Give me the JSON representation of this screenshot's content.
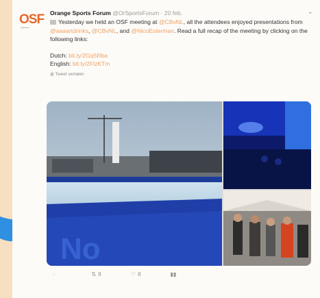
{
  "tweet": {
    "logo_text": "OSF",
    "author_name": "Orange Sports Forum",
    "handle": "@OrSportsForum",
    "time": "20 feb.",
    "body_prefix": "Yesterday we held an OSF meeting at",
    "mention1": "@CBvNL",
    "body_mid": ", all the attendees enjoyed presentations from",
    "mention2": "@aaaartdrinks",
    "sep1": ",",
    "mention3": "@CBvNL",
    "sep2": ", and",
    "mention4": "@NicoEsterman",
    "body_suffix": ". Read a full recap of the meeting by clicking on the following links:",
    "dutch_label": "Dutch:",
    "dutch_link": "bit.ly/2Gq5Rba",
    "english_label": "English:",
    "english_link": "bit.ly/2FlzKTm",
    "translate": "Tweet vertalen",
    "retweets": "8",
    "likes": "8"
  },
  "colors": {
    "background": "#f7dfc2",
    "brand_orange": "#e4672a",
    "link": "#f0a060",
    "twitter_blue": "#2f8fe0"
  }
}
